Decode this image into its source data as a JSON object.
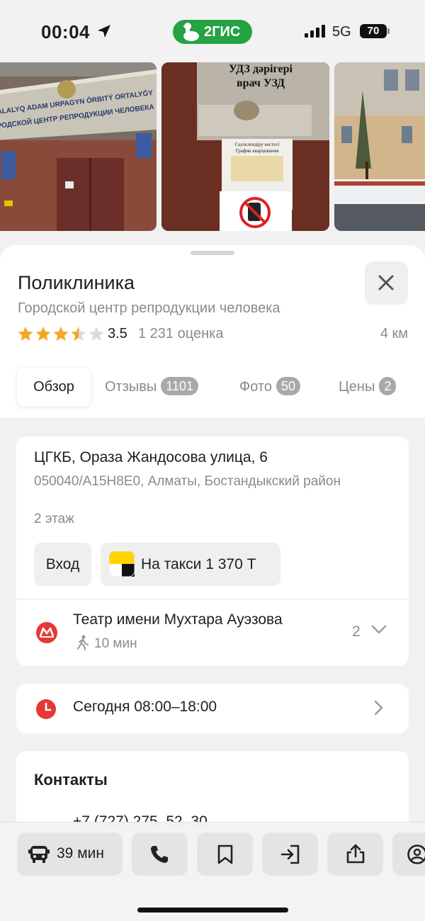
{
  "status_bar": {
    "time": "00:04",
    "app_badge": "2ГИС",
    "network": "5G",
    "battery": "70"
  },
  "photos": {
    "photo1_sign_line1": "ALALYQ ADAM URPAGYN ÓRBITÝ ORTALYǴY",
    "photo1_sign_line2": "РОДСКОЙ ЦЕНТР РЕПРОДУКЦИИ ЧЕЛОВЕКА",
    "photo2_sign_line1": "УДЗ дәрігері",
    "photo2_sign_line2": "врач УЗД",
    "photo2_schedule_title1": "Сәулелендіру кестесі",
    "photo2_schedule_title2": "График кварцевания"
  },
  "place": {
    "title": "Поликлиника",
    "subtitle": "Городской центр репродукции человека",
    "rating": "3.5",
    "rating_value": 3.5,
    "rating_count": "1 231 оценка",
    "distance": "4 км"
  },
  "tabs": [
    {
      "label": "Обзор",
      "badge": ""
    },
    {
      "label": "Отзывы",
      "badge": "1101"
    },
    {
      "label": "Фото",
      "badge": "50"
    },
    {
      "label": "Цены",
      "badge": "2"
    }
  ],
  "address": {
    "main": "ЦГКБ, Ораза Жандосова улица, 6",
    "sub": "050040/A15H8E0, Алматы, Бостандыкский район",
    "floor": "2 этаж",
    "entrance_label": "Вход",
    "taxi_label": "На такси 1 370 Т"
  },
  "metro": {
    "name": "Театр имени Мухтара Ауэзова",
    "walk_time": "10 мин",
    "count": "2"
  },
  "hours": {
    "text": "Сегодня 08:00–18:00"
  },
  "contacts": {
    "title": "Контакты",
    "phone": "+7 (727) 275‒52‒30"
  },
  "bottom_bar": {
    "route_label": "39 мин"
  },
  "colors": {
    "brand_green": "#25a244",
    "star": "#f5a623",
    "metro_red": "#e53935",
    "taxi_yellow": "#ffd400"
  }
}
